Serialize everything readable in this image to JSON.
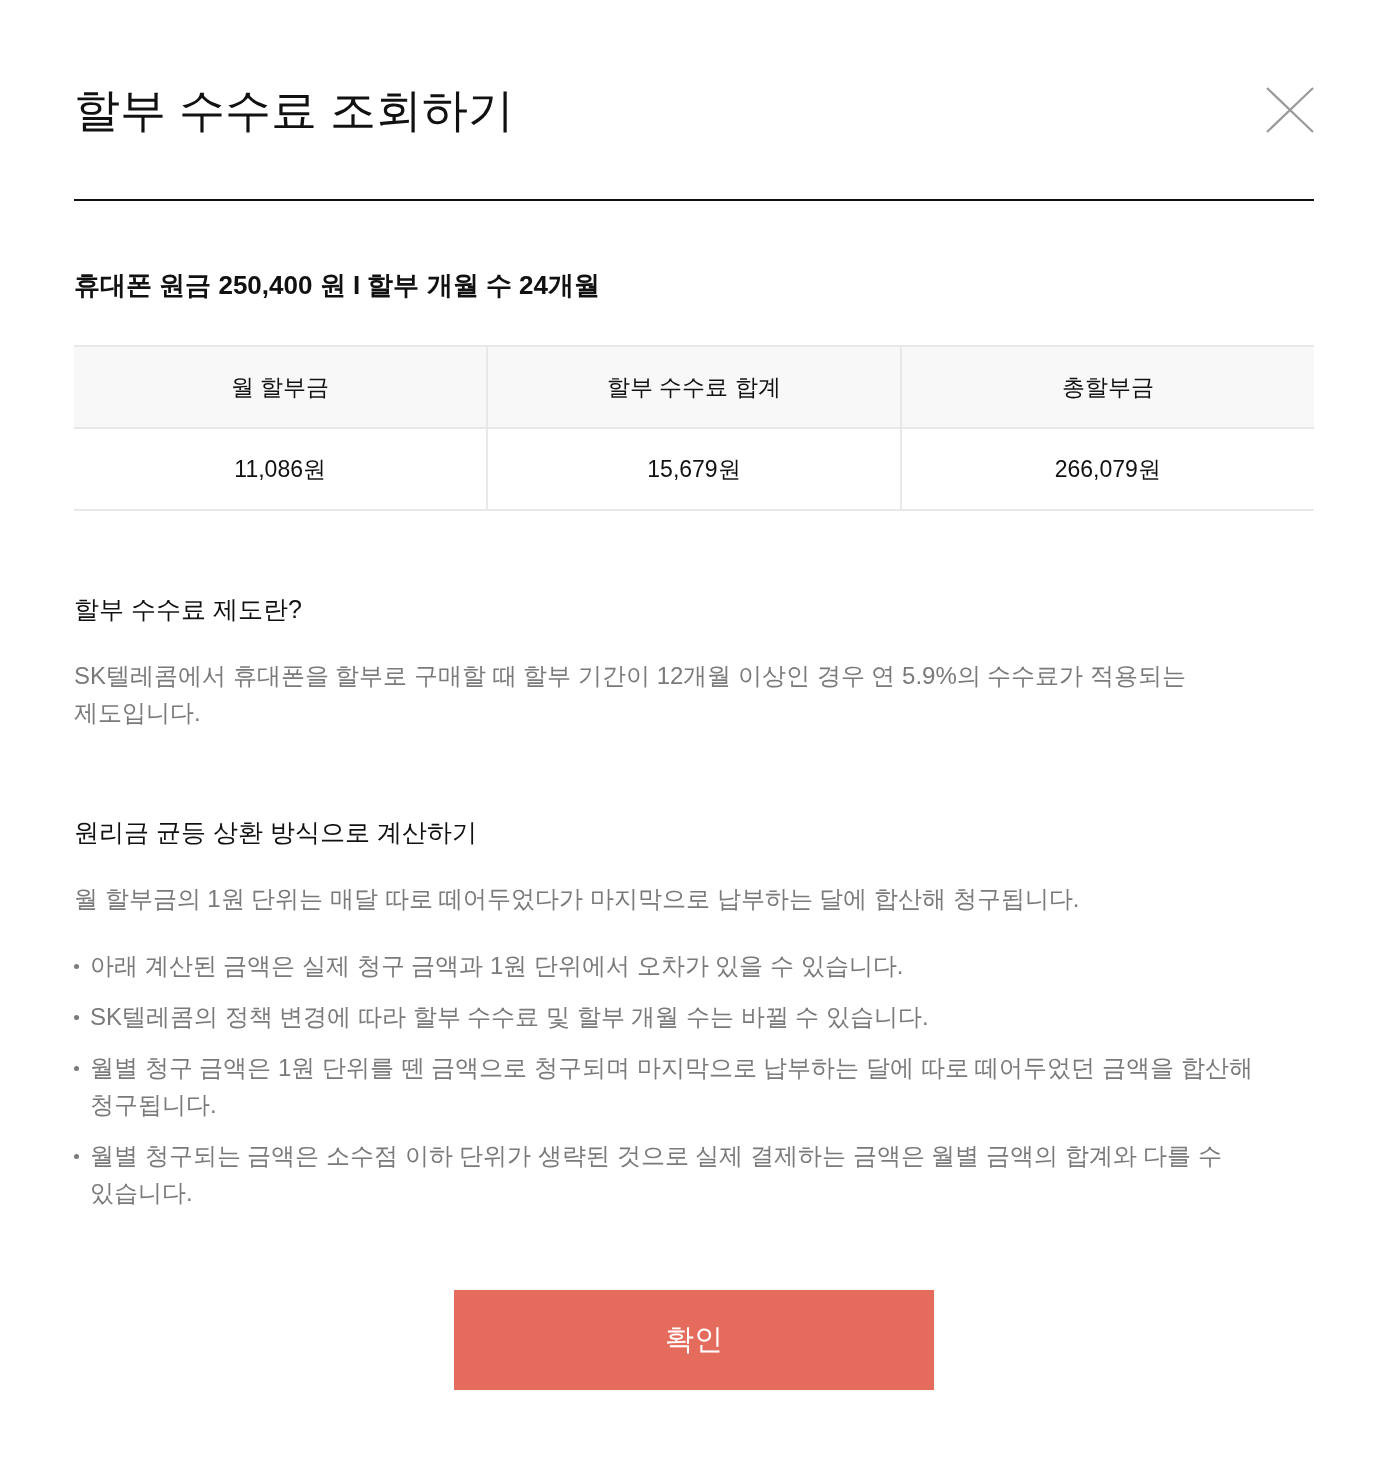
{
  "dialog": {
    "title": "할부 수수료 조회하기",
    "summary": "휴대폰 원금 250,400 원 I 할부 개월 수 24개월"
  },
  "table": {
    "columns": [
      "월 할부금",
      "할부 수수료 합계",
      "총할부금"
    ],
    "rows": [
      [
        "11,086원",
        "15,679원",
        "266,079원"
      ]
    ]
  },
  "sections": [
    {
      "heading": "할부 수수료 제도란?",
      "paragraph": "SK텔레콤에서 휴대폰을 할부로 구매할 때 할부 기간이 12개월 이상인 경우 연 5.9%의 수수료가 적용되는 제도입니다."
    },
    {
      "heading": "원리금 균등 상환 방식으로 계산하기",
      "paragraph": "월 할부금의 1원 단위는 매달 따로 떼어두었다가 마지막으로 납부하는 달에 합산해 청구됩니다.",
      "notes": [
        "아래 계산된 금액은 실제 청구 금액과 1원 단위에서 오차가 있을 수 있습니다.",
        "SK텔레콤의 정책 변경에 따라 할부 수수료 및 할부 개월 수는 바뀔 수 있습니다.",
        "월별 청구 금액은 1원 단위를 뗀 금액으로 청구되며 마지막으로 납부하는 달에 따로 떼어두었던 금액을 합산해 청구됩니다.",
        "월별 청구되는 금액은 소수점 이하 단위가 생략된 것으로 실제 결제하는 금액은 월별 금액의 합계와 다를 수 있습니다."
      ]
    }
  ],
  "buttons": [
    "확인"
  ]
}
